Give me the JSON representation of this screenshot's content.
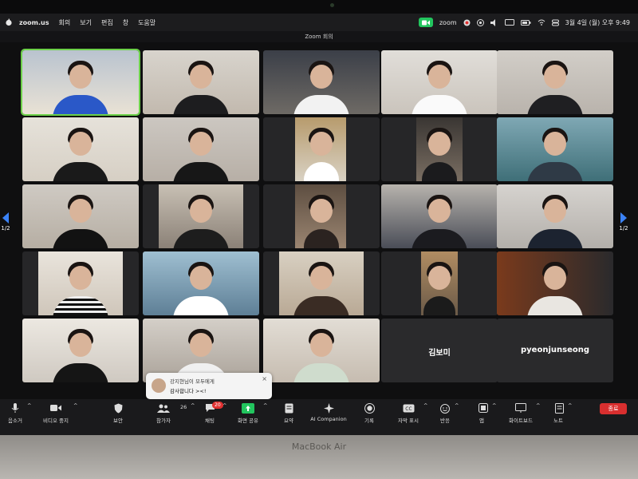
{
  "menubar": {
    "app_name": "zoom.us",
    "menu_items": [
      "회의",
      "보기",
      "편집",
      "창",
      "도움말"
    ],
    "status_zoom_label": "zoom",
    "datetime": "3월 4일 (월) 오후 9:49"
  },
  "window": {
    "title": "Zoom 회의"
  },
  "pager": {
    "left": "1/2",
    "right": "1/2"
  },
  "name_tiles": [
    "김보미",
    "pyeonjunseong"
  ],
  "toast": {
    "sender_line": "강지현님이 모두에게",
    "message": "감사합니다 ><!"
  },
  "toolbar": {
    "mute": "음소거",
    "stop_video": "비디오 중지",
    "security": "보안",
    "participants": "참가자",
    "participant_count": "26",
    "chat": "채팅",
    "chat_badge": "20",
    "share_screen": "화면 공유",
    "summary": "요약",
    "ai_companion": "AI Companion",
    "record": "기록",
    "captions": "자막 표시",
    "reactions": "반응",
    "apps": "앱",
    "whiteboard": "화이트보드",
    "notes": "노트",
    "end": "종료"
  },
  "laptop": {
    "brand": "MacBook Air"
  },
  "colors": {
    "active_speaker": "#6dd14a",
    "share_green": "#22c55e",
    "end_red": "#d92f2f",
    "badge_red": "#e03131"
  }
}
